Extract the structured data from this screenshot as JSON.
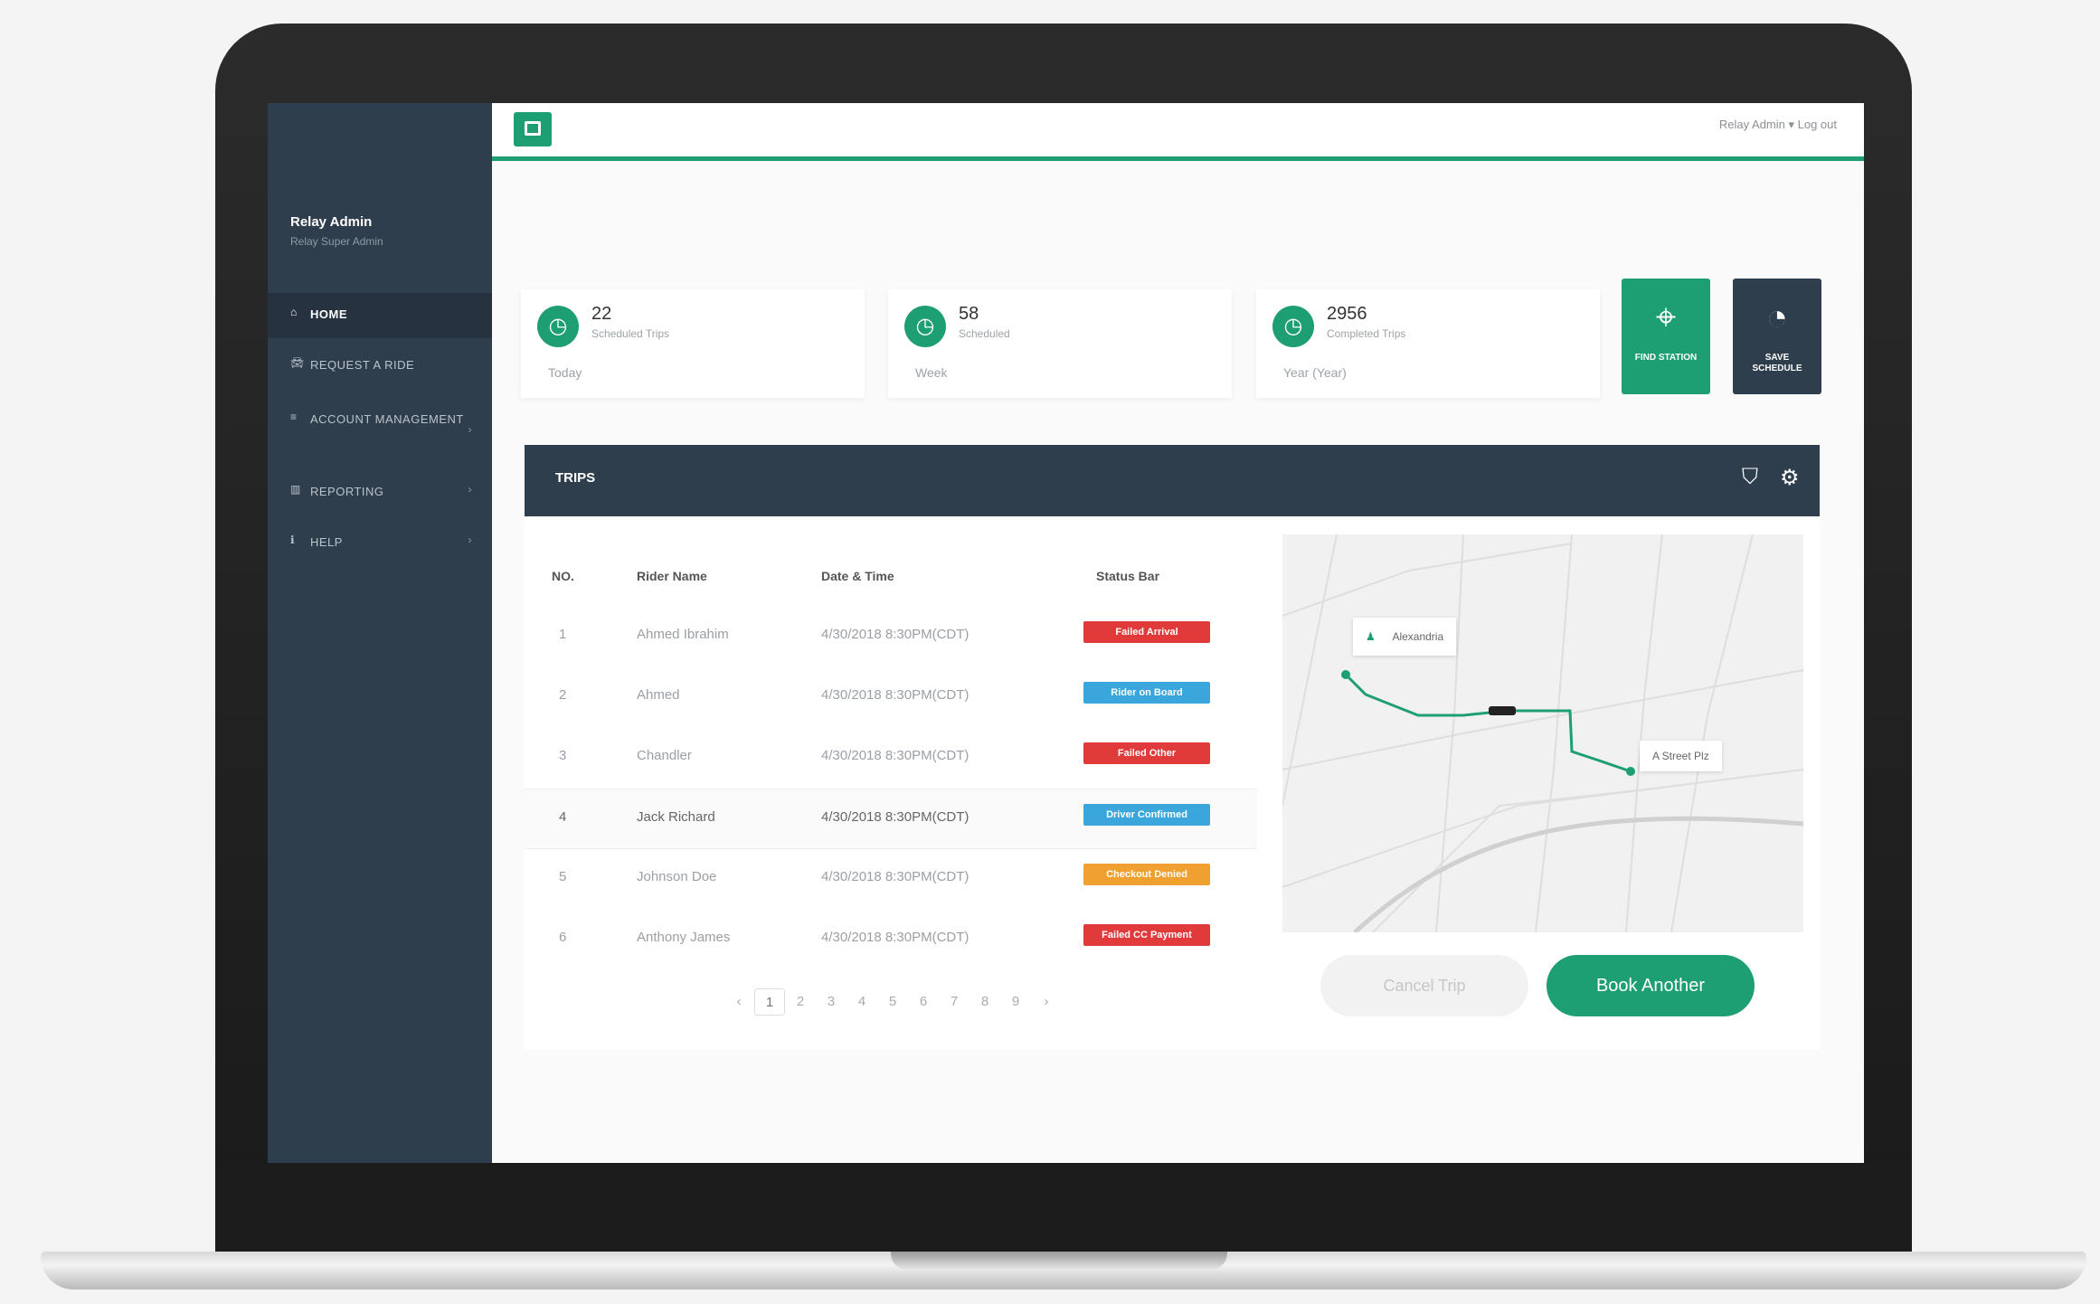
{
  "sidebar": {
    "user_name": "Relay Admin",
    "user_role": "Relay Super Admin",
    "items": [
      {
        "label": "HOME",
        "icon": "home-icon"
      },
      {
        "label": "REQUEST A RIDE",
        "icon": "car-icon"
      },
      {
        "label": "ACCOUNT MANAGEMENT",
        "icon": "list-icon"
      },
      {
        "label": "REPORTING",
        "icon": "chart-icon"
      },
      {
        "label": "HELP",
        "icon": "info-icon"
      }
    ]
  },
  "topbar": {
    "right_text": "Relay Admin ▾  Log out"
  },
  "stats": [
    {
      "value": "22",
      "label": "Scheduled Trips",
      "footer": "Today"
    },
    {
      "value": "58",
      "label": "Scheduled",
      "footer": "Week"
    },
    {
      "value": "2956",
      "label": "Completed Trips",
      "footer": "Year (Year)"
    }
  ],
  "quick_actions": [
    {
      "label": "FIND STATION",
      "icon": "map-pin-icon"
    },
    {
      "label": "SAVE SCHEDULE",
      "icon": "clock-icon"
    }
  ],
  "trips": {
    "title": "TRIPS",
    "columns": [
      "NO.",
      "Rider Name",
      "Date & Time",
      "Status Bar"
    ],
    "rows": [
      {
        "no": "1",
        "name": "Ahmed Ibrahim",
        "datetime": "4/30/2018 8:30PM(CDT)",
        "status": "Failed Arrival",
        "color": "#e03a3a"
      },
      {
        "no": "2",
        "name": "Ahmed",
        "datetime": "4/30/2018 8:30PM(CDT)",
        "status": "Rider on Board",
        "color": "#3aa6dc"
      },
      {
        "no": "3",
        "name": "Chandler",
        "datetime": "4/30/2018 8:30PM(CDT)",
        "status": "Failed Other",
        "color": "#e03a3a"
      },
      {
        "no": "4",
        "name": "Jack Richard",
        "datetime": "4/30/2018 8:30PM(CDT)",
        "status": "Driver Confirmed",
        "color": "#3aa6dc"
      },
      {
        "no": "5",
        "name": "Johnson Doe",
        "datetime": "4/30/2018 8:30PM(CDT)",
        "status": "Checkout Denied",
        "color": "#f0a030"
      },
      {
        "no": "6",
        "name": "Anthony James",
        "datetime": "4/30/2018 8:30PM(CDT)",
        "status": "Failed CC Payment",
        "color": "#e03a3a"
      }
    ],
    "pager": [
      "‹",
      "1",
      "2",
      "3",
      "4",
      "5",
      "6",
      "7",
      "8",
      "9",
      "›"
    ]
  },
  "map": {
    "pickup_label": "Alexandria",
    "dropoff_label": "A Street Plz"
  },
  "buttons": {
    "cancel": "Cancel Trip",
    "book": "Book Another"
  },
  "colors": {
    "accent": "#1e9e73",
    "sidebar": "#2f3e4d"
  }
}
